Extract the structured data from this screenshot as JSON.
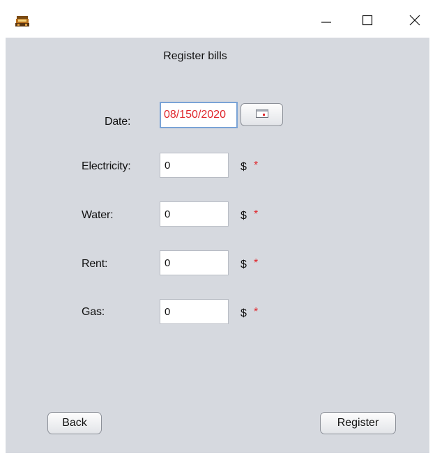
{
  "window": {
    "minimize_symbol": "—",
    "maximize_symbol": "☐",
    "close_symbol": "✕",
    "app_icon": "app-icon"
  },
  "form": {
    "title": "Register bills",
    "date": {
      "label": "Date:",
      "value": "08/150/2020"
    },
    "electricity": {
      "label": "Electricity:",
      "value": "0",
      "unit": "$",
      "required": "*"
    },
    "water": {
      "label": "Water:",
      "value": "0",
      "unit": "$",
      "required": "*"
    },
    "rent": {
      "label": "Rent:",
      "value": "0",
      "unit": "$",
      "required": "*"
    },
    "gas": {
      "label": "Gas:",
      "value": "0",
      "unit": "$",
      "required": "*"
    }
  },
  "buttons": {
    "back": "Back",
    "register": "Register"
  },
  "colors": {
    "panel_bg": "#d6d9df",
    "required": "#e0262c",
    "date_text": "#e0262c",
    "focus_border": "#7aa3d6"
  }
}
